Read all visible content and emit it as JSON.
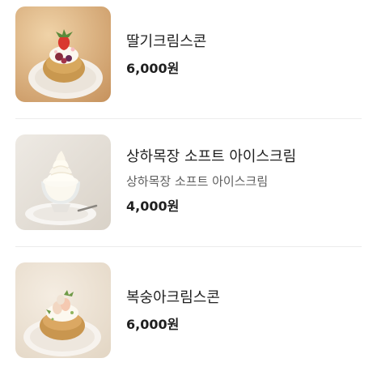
{
  "menu": {
    "items": [
      {
        "name": "딸기크림스콘",
        "price": "6,000원",
        "image_icon": "strawberry-cream-scone-photo"
      },
      {
        "name": "상하목장 소프트 아이스크림",
        "description": "상하목장 소프트 아이스크림",
        "price": "4,000원",
        "image_icon": "soft-ice-cream-photo"
      },
      {
        "name": "복숭아크림스콘",
        "price": "6,000원",
        "image_icon": "peach-cream-scone-photo"
      }
    ]
  },
  "colors": {
    "text_primary": "#1f1f1f",
    "text_secondary": "#5e5e5e",
    "divider": "#ececec",
    "photo_bg_warm": "#d8b080",
    "photo_bg_cool": "#e8e3dc"
  }
}
